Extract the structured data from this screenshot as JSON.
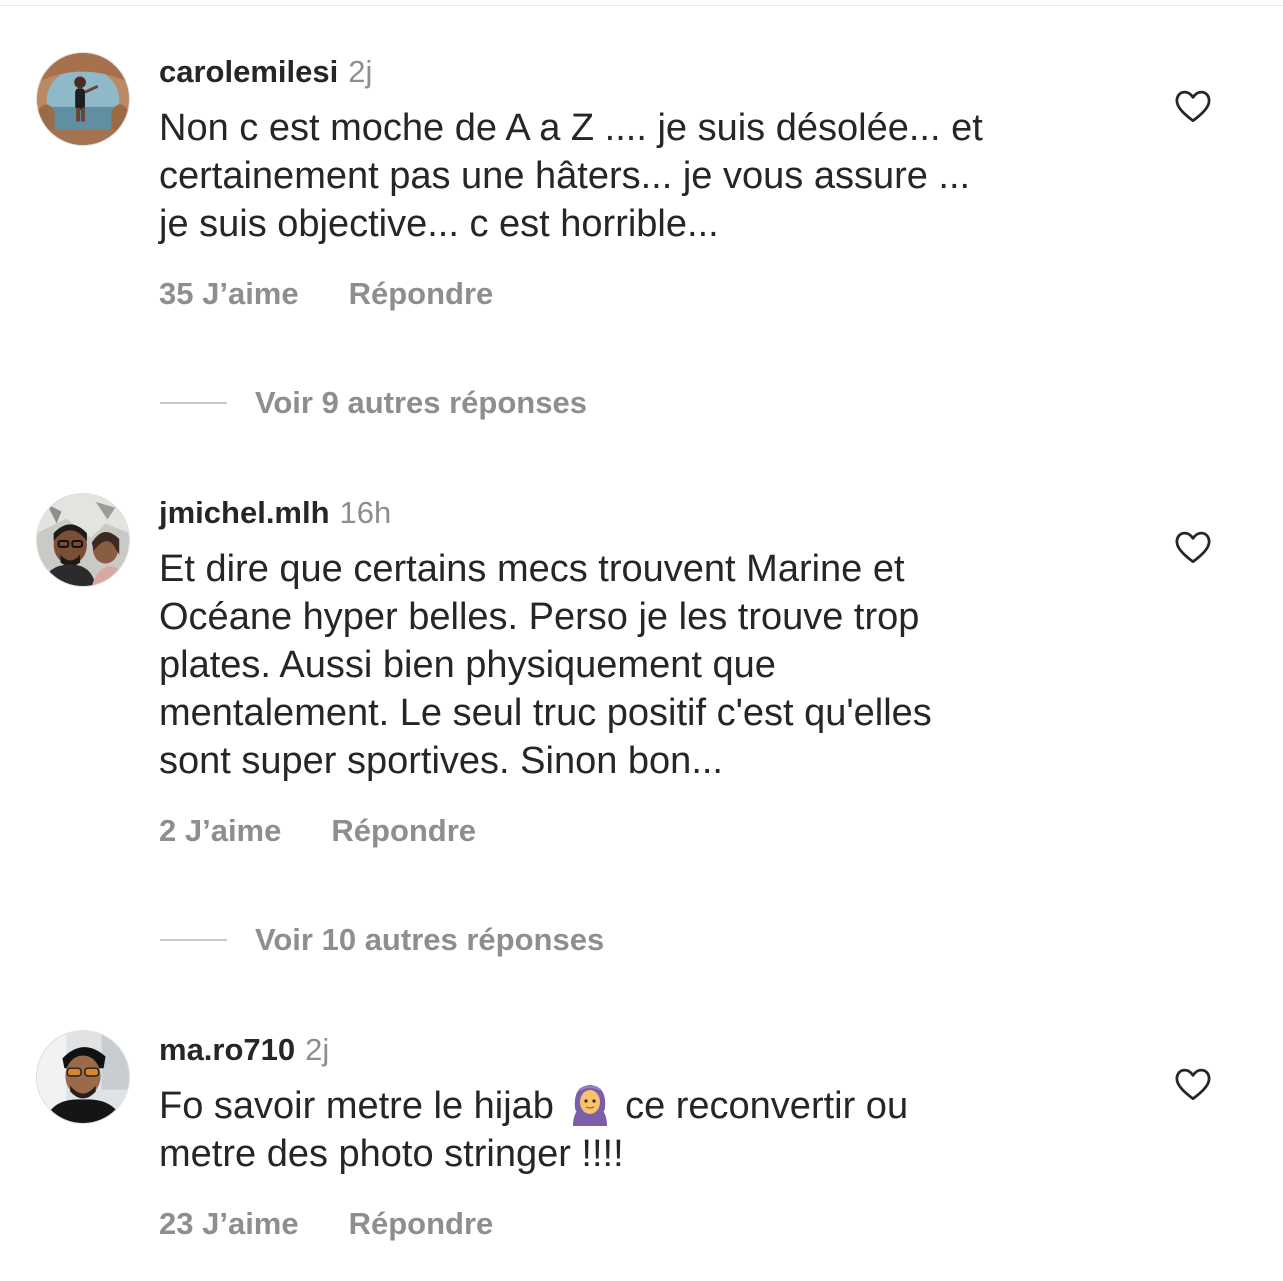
{
  "comments": [
    {
      "username": "carolemilesi",
      "time": "2j",
      "text_lines": [
        "Non c est moche de A a Z .... je suis désolée... et",
        "certainement pas une hâters... je vous assure ...",
        "je suis objective... c est horrible..."
      ],
      "likes": "35 J’aime",
      "reply": "Répondre",
      "view_replies": "Voir 9 autres réponses"
    },
    {
      "username": "jmichel.mlh",
      "time": "16h",
      "text_lines": [
        "Et dire que certains mecs trouvent Marine et",
        "Océane hyper belles. Perso je les trouve trop",
        "plates. Aussi bien physiquement que",
        "mentalement. Le seul truc positif c'est qu'elles",
        "sont super sportives. Sinon bon..."
      ],
      "likes": "2 J’aime",
      "reply": "Répondre",
      "view_replies": "Voir 10 autres réponses"
    },
    {
      "username": "ma.ro710",
      "time": "2j",
      "text_lines": [
        "Fo savoir metre le hijab",
        "ce reconvertir ou",
        "metre des photo stringer !!!!"
      ],
      "likes": "23 J’aime",
      "reply": "Répondre"
    }
  ],
  "icons": {
    "like": "heart-outline-icon",
    "emoji": "woman-with-headscarf-emoji"
  },
  "colors": {
    "text": "#262626",
    "secondary": "#8e8e8e",
    "divider": "#c7c7c7"
  }
}
